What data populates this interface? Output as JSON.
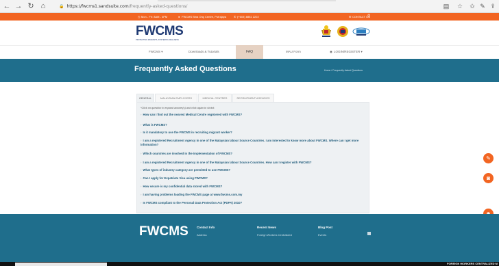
{
  "browser": {
    "url_host": "https://fwcms1.sandsuite.com",
    "url_path": "/frequently-asked-questions/"
  },
  "topbar": {
    "hours": "Mon - Fri: 8AM - 4PM",
    "address": "FWCMS Bina Ong Centre, Putrajaya",
    "phone": "(+603) 8881 2222",
    "contact": "CONTACT US"
  },
  "header": {
    "logo_text": "FWCMS",
    "logo_tag": "PROTECTING MIGRANTS, FOSTERING WELLNESS"
  },
  "nav": {
    "items": [
      {
        "label": "FWCMS ▾"
      },
      {
        "label": "Downloads & Tutorials"
      },
      {
        "label": "FAQ"
      },
      {
        "label": "MAU Form"
      },
      {
        "label": "LOGIN/REGISTER ▾"
      }
    ]
  },
  "hero": {
    "title": "Frequently Asked Questions",
    "breadcrumb": "Home / Frequently Asked Questions"
  },
  "faq": {
    "tabs": [
      {
        "label": "GENERAL"
      },
      {
        "label": "MALAYSIAN EMPLOYERS"
      },
      {
        "label": "MEDICAL CENTRES"
      },
      {
        "label": "RECRUITMENT AGENCIES"
      }
    ],
    "hint": "*Click on question to expand answer(s) and click again to shrink.",
    "questions": [
      {
        "text": "How can I find out the nearest Medical Centre registered with FWCMS?"
      },
      {
        "text": "What is FWCMS?"
      },
      {
        "text": "Is it mandatory to use the FWCMS in recruiting migrant worker?"
      },
      {
        "text": "I am a registered Recruitment Agency in one of the Malaysian labour Source Countries. I am interested to know more about FWCMS. Where can I get more information?"
      },
      {
        "text": "Which countries are involved in the implementation of FWCMS?"
      },
      {
        "text": "I am a registered Recruitment Agency in one of the Malaysian labour Source Countries. How can I register with FWCMS?"
      },
      {
        "text": "What types of industry category are permitted to use FWCMS?"
      },
      {
        "text": "Can I apply for Expatriate Visa using FWCMS?"
      },
      {
        "text": "How secure is my confidential data stored with FWCMS?"
      },
      {
        "text": "I am having problems loading the FWCMS page at www.fwcms.com.my"
      },
      {
        "text": "Is FWCMS compliant to the Personal Data Protection Act (PDPA) 2010?"
      }
    ]
  },
  "footer": {
    "logo_text": "FWCMS",
    "col1_title": "Contact Info",
    "col1_item": "Address",
    "col2_title": "Recent News",
    "col2_item": "Foreign Workers Centralized",
    "col3_title": "Blog Post",
    "col3_item": "Events"
  },
  "bottombar": {
    "ticker": "FOREIGN WORKERS CENTRALIZED M"
  },
  "colors": {
    "orange": "#f26522",
    "teal": "#1f6e8c",
    "navy": "#1f3a73"
  }
}
